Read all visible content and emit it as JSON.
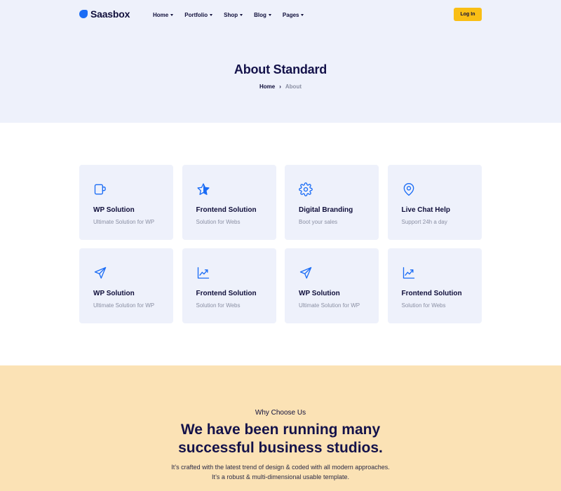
{
  "brand": {
    "name": "Saasbox",
    "color": "#1a6cf5"
  },
  "nav": {
    "items": [
      {
        "label": "Home"
      },
      {
        "label": "Portfolio"
      },
      {
        "label": "Shop"
      },
      {
        "label": "Blog"
      },
      {
        "label": "Pages"
      }
    ],
    "login_label": "Log In",
    "login_color": "#f9be15"
  },
  "hero": {
    "title": "About Standard",
    "breadcrumb": {
      "home": "Home",
      "separator": "›",
      "current": "About"
    }
  },
  "features": [
    {
      "icon": "cup-icon",
      "title": "WP Solution",
      "subtitle": "Ultimate Solution for WP"
    },
    {
      "icon": "star-icon",
      "title": "Frontend Solution",
      "subtitle": "Solution for Webs"
    },
    {
      "icon": "gear-icon",
      "title": "Digital Branding",
      "subtitle": "Boot your sales"
    },
    {
      "icon": "location-pin-icon",
      "title": "Live Chat Help",
      "subtitle": "Support 24h a day"
    },
    {
      "icon": "send-icon",
      "title": "WP Solution",
      "subtitle": "Ultimate Solution for WP"
    },
    {
      "icon": "chart-up-icon",
      "title": "Frontend Solution",
      "subtitle": "Solution for Webs"
    },
    {
      "icon": "send-icon",
      "title": "WP Solution",
      "subtitle": "Ultimate Solution for WP"
    },
    {
      "icon": "chart-up-icon",
      "title": "Frontend Solution",
      "subtitle": "Solution for Webs"
    }
  ],
  "why": {
    "eyebrow": "Why Choose Us",
    "title_line1": "We have been running many",
    "title_line2": "successful business studios.",
    "text_line1": "It’s crafted with the latest trend of design & coded with all modern approaches.",
    "text_line2": "It’s a robust & multi-dimensional usable template."
  }
}
